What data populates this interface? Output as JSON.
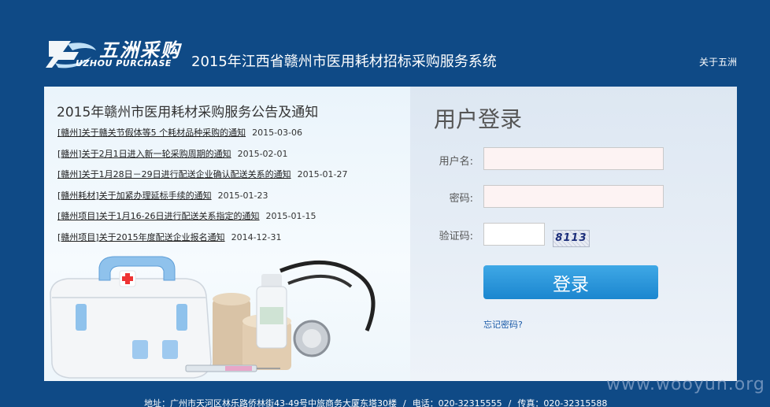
{
  "header": {
    "logo_cn": "五洲采购",
    "logo_en": "UZHOU PURCHASE",
    "system_title": "2015年江西省赣州市医用耗材招标采购服务系统",
    "about_label": "关于五洲"
  },
  "notices": {
    "title": "2015年赣州市医用耗材采购服务公告及通知",
    "items": [
      {
        "text": "[赣州]关于赣关节假体等5 个耗材品种采购的通知",
        "date": "2015-03-06"
      },
      {
        "text": "[赣州]关于2月1日进入新一轮采购周期的通知",
        "date": "2015-02-01"
      },
      {
        "text": "[赣州]关于1月28日－29日进行配送企业确认配送关系的通知",
        "date": "2015-01-27"
      },
      {
        "text": "[赣州耗材]关于加紧办理延标手续的通知",
        "date": "2015-01-23"
      },
      {
        "text": "[赣州项目]关于1月16-26日进行配送关系指定的通知",
        "date": "2015-01-15"
      },
      {
        "text": "[赣州项目]关于2015年度配送企业报名通知",
        "date": "2014-12-31"
      }
    ]
  },
  "login": {
    "title": "用户登录",
    "username_label": "用户名:",
    "password_label": "密码:",
    "captcha_label": "验证码:",
    "username_value": "",
    "password_value": "",
    "captcha_value": "",
    "captcha_text": "8113",
    "submit_label": "登录",
    "forgot_label": "忘记密码?"
  },
  "footer": {
    "address": "地址：广州市天河区林乐路侨林街43-49号中旅商务大厦东塔30楼",
    "phone": "电话：020-32315555",
    "fax": "传真：020-32315588"
  },
  "watermark": "www.wooyun.org",
  "colors": {
    "background": "#0f4a86",
    "button": "#1b86cf",
    "input_bg": "#fdf3f3"
  }
}
